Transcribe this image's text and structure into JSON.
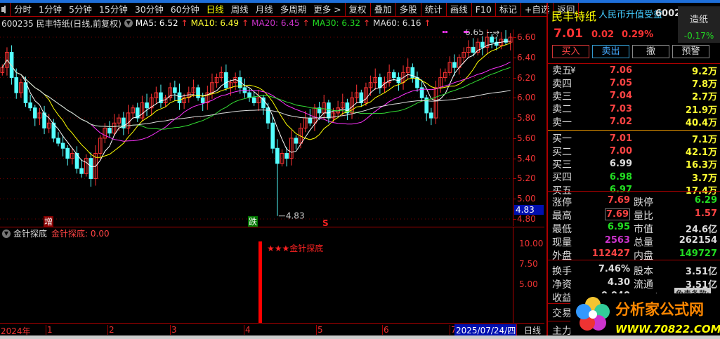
{
  "menu": {
    "items": [
      "分时",
      "1分钟",
      "5分钟",
      "15分钟",
      "30分钟",
      "60分钟",
      "日线",
      "周线",
      "月线",
      "多周期",
      "更多 >"
    ],
    "selected": "日线",
    "tools": [
      "复权",
      "叠加",
      "多股",
      "统计",
      "画线",
      "F10",
      "标记",
      "+自选",
      "返回"
    ]
  },
  "info": {
    "title": "600235 民丰特纸(日线,前复权)",
    "ma5": "MA5: 6.52",
    "ma10": "MA10: 6.49",
    "ma20": "MA20: 6.45",
    "ma30": "MA30: 6.32",
    "ma60": "MA60: 6.16"
  },
  "colors": {
    "ma5": "#ffffff",
    "ma10": "#ffff00",
    "ma20": "#ff33ff",
    "ma30": "#33dd33",
    "ma60": "#dddddd",
    "up": "#ff3333",
    "down": "#55ffff"
  },
  "chart_data": {
    "type": "candlestick",
    "ylim": [
      4.7,
      6.75
    ],
    "yticks": [
      "6.60",
      "6.40",
      "6.20",
      "6.00",
      "5.80",
      "5.60",
      "5.40",
      "5.20",
      "5.00",
      "4.80"
    ],
    "closes": [
      6.3,
      6.45,
      6.2,
      6.05,
      6.15,
      5.95,
      5.9,
      5.8,
      5.85,
      5.7,
      5.75,
      5.6,
      5.55,
      5.5,
      5.4,
      5.45,
      5.3,
      5.25,
      5.4,
      5.2,
      5.45,
      5.6,
      5.7,
      5.65,
      5.75,
      5.8,
      5.7,
      5.85,
      5.9,
      5.8,
      5.95,
      5.9,
      6.0,
      6.05,
      5.95,
      6.0,
      6.1,
      6.05,
      5.95,
      6.0,
      6.05,
      6.1,
      6.0,
      5.95,
      6.05,
      6.15,
      6.2,
      6.25,
      6.1,
      6.15,
      6.2,
      6.1,
      6.05,
      6.0,
      5.95,
      6.0,
      5.9,
      5.75,
      5.5,
      5.35,
      5.45,
      5.4,
      5.6,
      5.55,
      5.7,
      5.8,
      5.75,
      5.9,
      5.85,
      5.95,
      5.8,
      5.85,
      5.9,
      5.95,
      5.85,
      6.0,
      6.05,
      5.95,
      6.1,
      6.15,
      6.2,
      6.1,
      6.15,
      6.25,
      6.2,
      6.15,
      6.25,
      6.3,
      6.2,
      6.1,
      6.0,
      5.85,
      5.8,
      6.1,
      6.2,
      6.25,
      6.35,
      6.3,
      6.4,
      6.45,
      6.5,
      6.45,
      6.55,
      6.5,
      6.6,
      6.55,
      6.52,
      6.58,
      6.55,
      6.6
    ],
    "high_label": "6.65",
    "low_label": "4.83",
    "low_value": 4.83,
    "current": "4.83",
    "markers": {
      "zeng": "增",
      "die": "跌",
      "s": "S"
    }
  },
  "indicator": {
    "name": "金针探底",
    "label": "金针探底: 0.00",
    "signal": "★★★金针探底",
    "yticks": [
      "10.00",
      "7.50",
      "5.00"
    ]
  },
  "dates": {
    "labels": [
      "2024年",
      "1",
      "2",
      "3",
      "4",
      "5",
      "6",
      "7"
    ],
    "current": "2025/07/24/四",
    "period": "日线"
  },
  "quote": {
    "name": "民丰特纸",
    "tag": "人民币升值受益",
    "code": "6002",
    "sector": "造纸",
    "sector_chg": "-0.17%",
    "price": "7.01",
    "chg": "0.02",
    "pct": "0.29%",
    "buttons": [
      "买入",
      "卖出",
      "撤",
      "预警"
    ],
    "asks": [
      {
        "l": "卖五",
        "p": "7.06",
        "v": "9.2万",
        "c": "r",
        "s": "¥"
      },
      {
        "l": "卖四",
        "p": "7.05",
        "v": "7.8万",
        "c": "r"
      },
      {
        "l": "卖三",
        "p": "7.04",
        "v": "2.7万",
        "c": "r"
      },
      {
        "l": "卖二",
        "p": "7.03",
        "v": "21.9万",
        "c": "r"
      },
      {
        "l": "卖一",
        "p": "7.02",
        "v": "40.4万",
        "c": "r"
      }
    ],
    "bids": [
      {
        "l": "买一",
        "p": "7.01",
        "v": "7.1万",
        "c": "r"
      },
      {
        "l": "买二",
        "p": "7.00",
        "v": "42.1万",
        "c": "r"
      },
      {
        "l": "买三",
        "p": "6.99",
        "v": "16.3万",
        "c": "w"
      },
      {
        "l": "买四",
        "p": "6.98",
        "v": "3.7万",
        "c": "g"
      },
      {
        "l": "买五",
        "p": "6.97",
        "v": "17.4万",
        "c": "g"
      }
    ],
    "stats": [
      [
        "涨停",
        "7.69",
        "r",
        "跌停",
        "6.29",
        "g"
      ],
      [
        "最高",
        "7.69",
        "r",
        "量比",
        "1.57",
        "r"
      ],
      [
        "最低",
        "6.95",
        "g",
        "市值",
        "24.6亿",
        "w"
      ],
      [
        "现量",
        "2563",
        "m",
        "总量",
        "262154",
        "w"
      ],
      [
        "外盘",
        "112427",
        "r",
        "内盘",
        "149727",
        "g"
      ]
    ],
    "stats2": [
      [
        "换手",
        "7.46%",
        "w",
        "股本",
        "3.51亿",
        "w"
      ],
      [
        "净资",
        "4.30",
        "w",
        "流通",
        "3.51亿",
        "w"
      ],
      [
        "收益(二)",
        "0.040",
        "w",
        "PE(动)",
        "",
        "w"
      ]
    ],
    "extra": [
      "交易",
      "主力"
    ],
    "disclaimer": "免责条款:"
  },
  "watermark": {
    "text": "分析家公式网",
    "url": "WWW.70822.COM"
  }
}
